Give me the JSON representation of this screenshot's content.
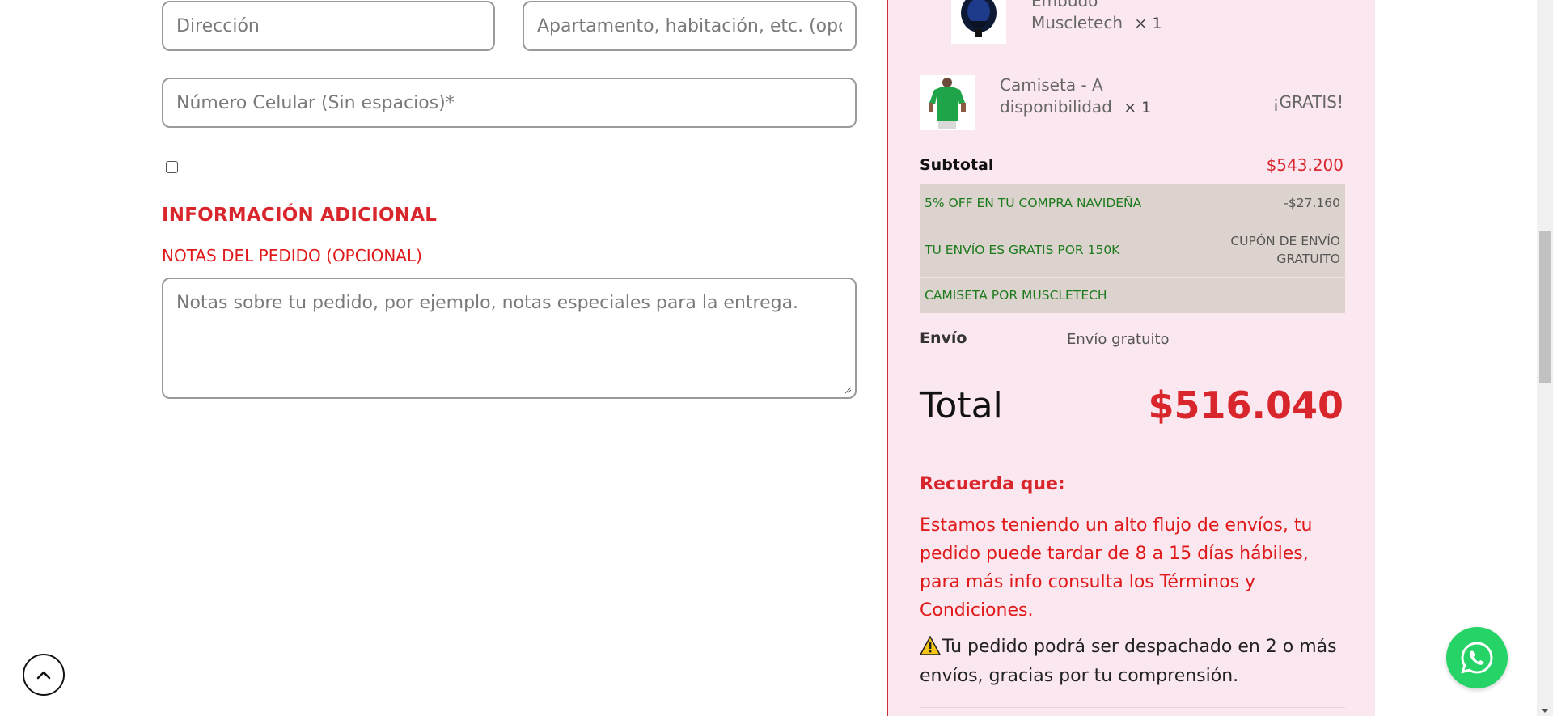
{
  "form": {
    "address_placeholder": "Dirección",
    "apartment_placeholder": "Apartamento, habitación, etc. (opc",
    "phone_placeholder": "Número Celular (Sin espacios)*",
    "section_title": "INFORMACIÓN ADICIONAL",
    "notes_label": "NOTAS DEL PEDIDO (OPCIONAL)",
    "notes_placeholder": "Notas sobre tu pedido, por ejemplo, notas especiales para la entrega."
  },
  "summary": {
    "items": [
      {
        "name_line1": "Embudo",
        "name_line2": "Muscletech",
        "qty": "× 1",
        "price": ""
      },
      {
        "name_line1": "Camiseta - A",
        "name_line2": "disponibilidad",
        "qty": "× 1",
        "price": "¡GRATIS!"
      }
    ],
    "subtotal_label": "Subtotal",
    "subtotal_value": "$543.200",
    "discounts": [
      {
        "label": "5% OFF EN TU COMPRA NAVIDEÑA",
        "value": "-$27.160"
      },
      {
        "label": "TU ENVÍO ES GRATIS POR 150K",
        "value_line1": "CUPÓN DE ENVÍO",
        "value_line2": "GRATUITO"
      },
      {
        "label": "CAMISETA POR MUSCLETECH",
        "value": ""
      }
    ],
    "shipping_label": "Envío",
    "shipping_value": "Envío gratuito",
    "total_label": "Total",
    "total_value": "$516.040",
    "reminder_title": "Recuerda que:",
    "reminder_lines": [
      "Estamos teniendo un alto flujo de envíos, tu",
      "pedido puede tardar de 8 a 15 días hábiles,",
      "para más info consulta los Términos y",
      "Condiciones."
    ],
    "warning_lines": [
      "Tu pedido podrá ser despachado en 2 o más",
      "envíos, gracias por tu comprensión."
    ]
  },
  "colors": {
    "accent_red": "#d8262c",
    "summary_bg": "#fbe7f0",
    "discount_green": "#1d7a1d",
    "whatsapp_green": "#25d366"
  },
  "icons": {
    "scroll_top": "chevron-up-icon",
    "whatsapp": "whatsapp-icon",
    "warning": "warning-icon"
  }
}
